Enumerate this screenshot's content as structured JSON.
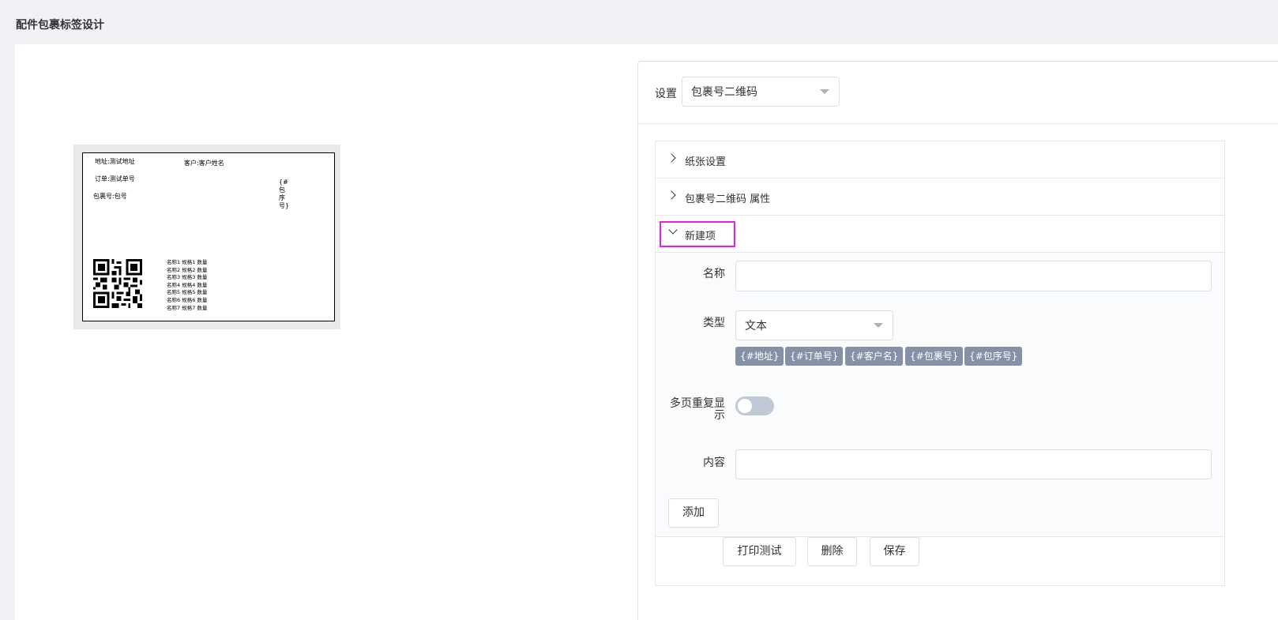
{
  "page": {
    "title": "配件包裹标签设计"
  },
  "label": {
    "address": "地址:测试地址",
    "customer": "客户:客户姓名",
    "order": "订单:测试单号",
    "package": "包裹号:包号",
    "vertical": "{#包序号}",
    "items": [
      "名称1 规格1 数量",
      "名称2 规格2 数量",
      "名称3 规格3 数量",
      "名称4 规格4 数量",
      "名称5 规格5 数量",
      "名称6 规格6 数量",
      "名称7 规格7 数量"
    ]
  },
  "settings": {
    "label": "设置",
    "selected": "包裹号二维码"
  },
  "sections": {
    "paper": "纸张设置",
    "qr_props": "包裹号二维码 属性",
    "new_item": "新建项"
  },
  "form": {
    "name_label": "名称",
    "name_value": "",
    "type_label": "类型",
    "type_value": "文本",
    "tags": [
      "{#地址}",
      "{#订单号}",
      "{#客户名}",
      "{#包裹号}",
      "{#包序号}"
    ],
    "repeat_label": "多页重复显示",
    "repeat_on": false,
    "content_label": "内容",
    "content_value": "",
    "add_button": "添加"
  },
  "actions": {
    "print_test": "打印测试",
    "delete": "删除",
    "save": "保存"
  },
  "colors": {
    "highlight": "#e91ee6",
    "tag_bg": "#8591a6",
    "switch_off": "#c0cad6"
  }
}
